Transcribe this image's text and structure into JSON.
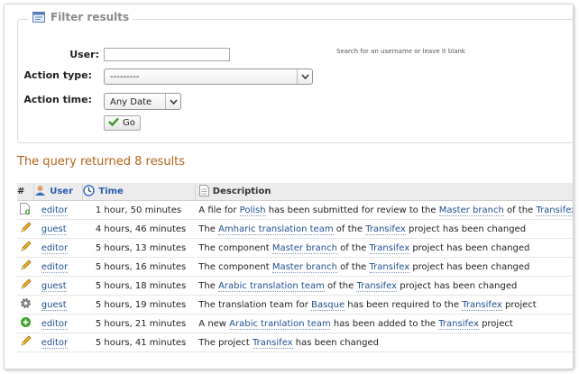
{
  "filter": {
    "legend": "Filter results",
    "user_label": "User:",
    "user_value": "",
    "user_hint": "Search for an username or leave it blank",
    "action_type_label": "Action type:",
    "action_type_value": "---------",
    "action_time_label": "Action time:",
    "action_time_value": "Any Date",
    "go_label": "Go"
  },
  "results_summary": "The query returned 8 results",
  "table": {
    "headers": {
      "num": "#",
      "user": "User",
      "time": "Time",
      "description": "Description"
    },
    "rows": [
      {
        "icon": "file-add-icon",
        "user": "editor",
        "time": "1 hour, 50 minutes",
        "desc": [
          [
            "A file for ",
            false
          ],
          [
            "Polish",
            true
          ],
          [
            " has been submitted for review to the ",
            false
          ],
          [
            "Master branch",
            true
          ],
          [
            " of the ",
            false
          ],
          [
            "Transifex",
            true
          ]
        ]
      },
      {
        "icon": "pencil-icon",
        "user": "guest",
        "time": "4 hours, 46 minutes",
        "desc": [
          [
            "The ",
            false
          ],
          [
            "Amharic translation team",
            true
          ],
          [
            " of the ",
            false
          ],
          [
            "Transifex",
            true
          ],
          [
            " project has been changed",
            false
          ]
        ]
      },
      {
        "icon": "pencil-icon",
        "user": "editor",
        "time": "5 hours, 13 minutes",
        "desc": [
          [
            "The component ",
            false
          ],
          [
            "Master branch",
            true
          ],
          [
            " of the ",
            false
          ],
          [
            "Transifex",
            true
          ],
          [
            " project has been changed",
            false
          ]
        ]
      },
      {
        "icon": "pencil-icon",
        "user": "editor",
        "time": "5 hours, 16 minutes",
        "desc": [
          [
            "The component ",
            false
          ],
          [
            "Master branch",
            true
          ],
          [
            " of the ",
            false
          ],
          [
            "Transifex",
            true
          ],
          [
            " project has been changed",
            false
          ]
        ]
      },
      {
        "icon": "pencil-icon",
        "user": "guest",
        "time": "5 hours, 18 minutes",
        "desc": [
          [
            "The ",
            false
          ],
          [
            "Arabic translation team",
            true
          ],
          [
            " of the ",
            false
          ],
          [
            "Transifex",
            true
          ],
          [
            " project has been changed",
            false
          ]
        ]
      },
      {
        "icon": "gear-icon",
        "user": "guest",
        "time": "5 hours, 19 minutes",
        "desc": [
          [
            "The translation team for ",
            false
          ],
          [
            "Basque",
            true
          ],
          [
            " has been required to the ",
            false
          ],
          [
            "Transifex",
            true
          ],
          [
            " project",
            false
          ]
        ]
      },
      {
        "icon": "add-green-icon",
        "user": "editor",
        "time": "5 hours, 21 minutes",
        "desc": [
          [
            "A new ",
            false
          ],
          [
            "Arabic tranlation team",
            true
          ],
          [
            " has been added to the ",
            false
          ],
          [
            "Transifex",
            true
          ],
          [
            " project",
            false
          ]
        ]
      },
      {
        "icon": "pencil-icon",
        "user": "editor",
        "time": "5 hours, 41 minutes",
        "desc": [
          [
            "The project ",
            false
          ],
          [
            "Transifex",
            true
          ],
          [
            " has been changed",
            false
          ]
        ]
      }
    ]
  },
  "colors": {
    "link": "#1f4f8f",
    "summary": "#b3641a",
    "header_bg": "#ececec"
  }
}
